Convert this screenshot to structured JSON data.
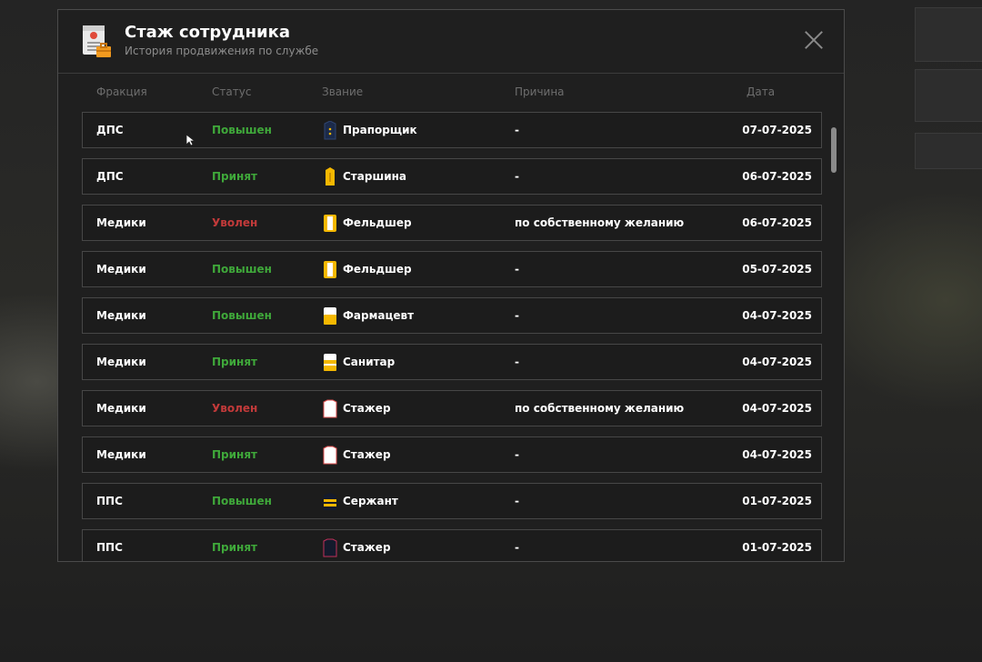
{
  "modal": {
    "title": "Стаж сотрудника",
    "subtitle": "История продвижения по службе"
  },
  "columns": {
    "faction": "Фракция",
    "status": "Статус",
    "rank": "Звание",
    "reason": "Причина",
    "date": "Дата"
  },
  "rows": [
    {
      "faction": "ДПС",
      "status": "Повышен",
      "status_type": "up",
      "rank": "Прапорщик",
      "rank_icon": "navy-shoulder-strap-icon",
      "reason": "-",
      "date": "07-07-2025"
    },
    {
      "faction": "ДПС",
      "status": "Принят",
      "status_type": "accepted",
      "rank": "Старшина",
      "rank_icon": "yellow-shoulder-strap-icon",
      "reason": "-",
      "date": "06-07-2025"
    },
    {
      "faction": "Медики",
      "status": "Уволен",
      "status_type": "fired",
      "rank": "Фельдшер",
      "rank_icon": "yellow-white-strap-icon",
      "reason": "по собственному желанию",
      "date": "06-07-2025"
    },
    {
      "faction": "Медики",
      "status": "Повышен",
      "status_type": "up",
      "rank": "Фельдшер",
      "rank_icon": "yellow-white-strap-icon",
      "reason": "-",
      "date": "05-07-2025"
    },
    {
      "faction": "Медики",
      "status": "Повышен",
      "status_type": "up",
      "rank": "Фармацевт",
      "rank_icon": "white-yellow-strap-icon",
      "reason": "-",
      "date": "04-07-2025"
    },
    {
      "faction": "Медики",
      "status": "Принят",
      "status_type": "accepted",
      "rank": "Санитар",
      "rank_icon": "striped-strap-icon",
      "reason": "-",
      "date": "04-07-2025"
    },
    {
      "faction": "Медики",
      "status": "Уволен",
      "status_type": "fired",
      "rank": "Стажер",
      "rank_icon": "white-strap-icon",
      "reason": "по собственному желанию",
      "date": "04-07-2025"
    },
    {
      "faction": "Медики",
      "status": "Принят",
      "status_type": "accepted",
      "rank": "Стажер",
      "rank_icon": "white-strap-icon",
      "reason": "-",
      "date": "04-07-2025"
    },
    {
      "faction": "ППС",
      "status": "Повышен",
      "status_type": "up",
      "rank": "Сержант",
      "rank_icon": "sergeant-strap-icon",
      "reason": "-",
      "date": "01-07-2025"
    },
    {
      "faction": "ППС",
      "status": "Принят",
      "status_type": "accepted",
      "rank": "Стажер",
      "rank_icon": "dark-strap-icon",
      "reason": "-",
      "date": "01-07-2025"
    }
  ],
  "colors": {
    "status_up": "#3fa83a",
    "status_accepted": "#3fa83a",
    "status_fired": "#c23a3a",
    "accent_yellow": "#f5b800"
  }
}
